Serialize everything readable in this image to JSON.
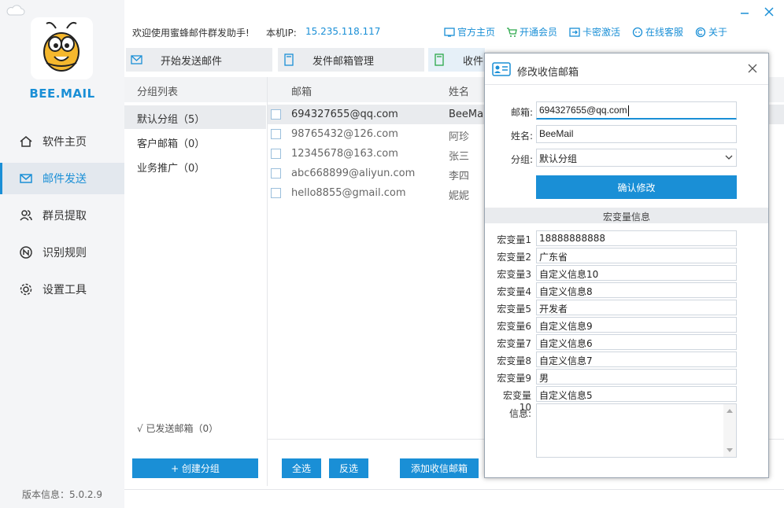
{
  "app": {
    "brand": "BEE.MAIL",
    "version": "版本信息：5.0.2.9"
  },
  "sidebar": {
    "items": [
      {
        "label": "软件主页",
        "icon": "home-icon"
      },
      {
        "label": "邮件发送",
        "icon": "mail-icon",
        "active": true
      },
      {
        "label": "群员提取",
        "icon": "users-icon"
      },
      {
        "label": "识别规则",
        "icon": "rules-icon"
      },
      {
        "label": "设置工具",
        "icon": "gear-icon"
      }
    ]
  },
  "header": {
    "welcome": "欢迎使用蜜蜂邮件群发助手!",
    "ip_label": "本机IP:",
    "ip_value": "15.235.118.117",
    "links": [
      {
        "label": "官方主页",
        "icon": "homepage-icon"
      },
      {
        "label": "开通会员",
        "icon": "cart-icon"
      },
      {
        "label": "卡密激活",
        "icon": "key-icon"
      },
      {
        "label": "在线客服",
        "icon": "chat-icon"
      },
      {
        "label": "关于",
        "icon": "copyright-icon"
      }
    ]
  },
  "tabs": [
    {
      "label": "开始发送邮件",
      "icon": "send-mail-icon"
    },
    {
      "label": "发件邮箱管理",
      "icon": "document-icon"
    },
    {
      "label": "收件",
      "icon": "document-icon",
      "active": true
    }
  ],
  "groups": {
    "header": "分组列表",
    "items": [
      {
        "label": "默认分组（5）",
        "selected": true
      },
      {
        "label": "客户邮箱（0）"
      },
      {
        "label": "业务推广（0）"
      }
    ],
    "sent": "√ 已发送邮箱（0）",
    "create_button": "+ 创建分组"
  },
  "table": {
    "col_email": "邮箱",
    "col_name": "姓名",
    "rows": [
      {
        "email": "694327655@qq.com",
        "name": "BeeMail"
      },
      {
        "email": "98765432@126.com",
        "name": "阿珍"
      },
      {
        "email": "12345678@163.com",
        "name": "张三"
      },
      {
        "email": "abc668899@aliyun.com",
        "name": "李四"
      },
      {
        "email": "hello8855@gmail.com",
        "name": "妮妮"
      }
    ],
    "select_all": "全选",
    "invert": "反选",
    "add": "添加收信邮箱"
  },
  "dialog": {
    "title": "修改收信邮箱",
    "email_label": "邮箱:",
    "email_value": "694327655@qq.com",
    "name_label": "姓名:",
    "name_value": "BeeMail",
    "group_label": "分组:",
    "group_value": "默认分组",
    "confirm": "确认修改",
    "macro_section": "宏变量信息",
    "macros": [
      {
        "label": "宏变量1",
        "value": "18888888888"
      },
      {
        "label": "宏变量2",
        "value": "广东省"
      },
      {
        "label": "宏变量3",
        "value": "自定义信息10"
      },
      {
        "label": "宏变量4",
        "value": "自定义信息8"
      },
      {
        "label": "宏变量5",
        "value": "开发者"
      },
      {
        "label": "宏变量6",
        "value": "自定义信息9"
      },
      {
        "label": "宏变量7",
        "value": "自定义信息6"
      },
      {
        "label": "宏变量8",
        "value": "自定义信息7"
      },
      {
        "label": "宏变量9",
        "value": "男"
      },
      {
        "label": "宏变量10",
        "value": "自定义信息5"
      }
    ],
    "info_label": "信息:"
  },
  "colors": {
    "accent": "#1a8fd6"
  }
}
